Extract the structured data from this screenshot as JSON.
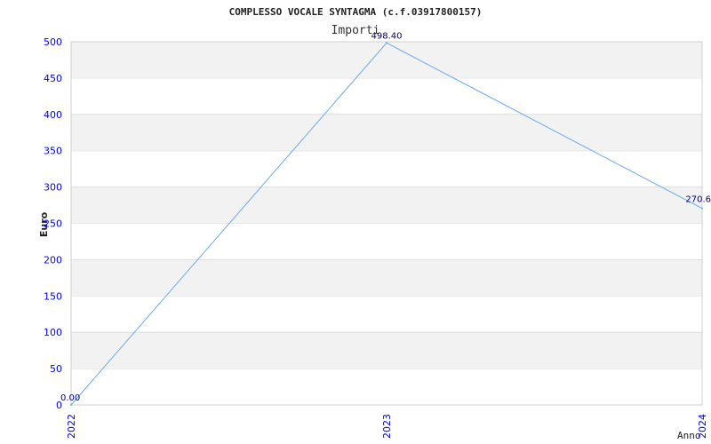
{
  "chart_data": {
    "type": "line",
    "title": "COMPLESSO VOCALE SYNTAGMA (c.f.03917800157)",
    "subtitle": "Importi",
    "xlabel": "Anno",
    "ylabel": "Euro",
    "categories": [
      "2022",
      "2023",
      "2024"
    ],
    "values": [
      0.0,
      498.4,
      270.6
    ],
    "data_labels": [
      "0.00",
      "498.40",
      "270.6"
    ],
    "ylim": [
      0,
      500
    ],
    "yticks": [
      "0",
      "50",
      "100",
      "150",
      "200",
      "250",
      "300",
      "350",
      "400",
      "450",
      "500"
    ],
    "grid": true,
    "colors": {
      "line": "#6aaaf0",
      "ticks": "#0000ff",
      "labels": "#000080",
      "band": "#f2f2f2",
      "grid": "#dddddd"
    }
  }
}
